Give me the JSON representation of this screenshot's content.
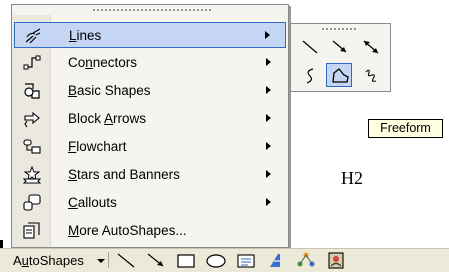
{
  "menu": {
    "items": [
      {
        "label": "Lines",
        "accel": "L",
        "rest": "ines",
        "pre": "",
        "icon": "lines-icon",
        "submenu": true
      },
      {
        "label": "Connectors",
        "pre": "Co",
        "accel": "n",
        "rest": "nectors",
        "icon": "connectors-icon",
        "submenu": true
      },
      {
        "label": "Basic Shapes",
        "pre": "",
        "accel": "B",
        "rest": "asic Shapes",
        "icon": "basic-shapes-icon",
        "submenu": true
      },
      {
        "label": "Block Arrows",
        "pre": "Block ",
        "accel": "A",
        "rest": "rrows",
        "icon": "block-arrows-icon",
        "submenu": true
      },
      {
        "label": "Flowchart",
        "pre": "",
        "accel": "F",
        "rest": "lowchart",
        "icon": "flowchart-icon",
        "submenu": true
      },
      {
        "label": "Stars and Banners",
        "pre": "",
        "accel": "S",
        "rest": "tars and Banners",
        "icon": "stars-banners-icon",
        "submenu": true
      },
      {
        "label": "Callouts",
        "pre": "",
        "accel": "C",
        "rest": "allouts",
        "icon": "callouts-icon",
        "submenu": true
      },
      {
        "label": "More AutoShapes...",
        "pre": "",
        "accel": "M",
        "rest": "ore AutoShapes...",
        "icon": "more-autoshapes-icon",
        "submenu": false
      }
    ]
  },
  "lines_submenu": {
    "tools": [
      {
        "name": "line-tool",
        "icon": "line-icon"
      },
      {
        "name": "arrow-tool",
        "icon": "arrow-icon"
      },
      {
        "name": "double-arrow-tool",
        "icon": "double-arrow-icon"
      },
      {
        "name": "curve-tool",
        "icon": "curve-icon"
      },
      {
        "name": "freeform-tool",
        "icon": "freeform-icon",
        "selected": true
      },
      {
        "name": "scribble-tool",
        "icon": "scribble-icon"
      }
    ]
  },
  "tooltip": {
    "text": "Freeform"
  },
  "document": {
    "text": "H2"
  },
  "toolbar": {
    "autoshapes_pre": "A",
    "autoshapes_accel": "u",
    "autoshapes_rest": "toShapes",
    "tools": [
      "line-icon",
      "arrow-icon",
      "rectangle-icon",
      "oval-icon",
      "text-box-icon",
      "wordart-icon",
      "diagram-icon",
      "clip-art-icon"
    ]
  },
  "colors": {
    "selection_fill": "#c5d6f4",
    "selection_border": "#3169c6",
    "menu_background": "#f6f4ef",
    "tooltip_background": "#ffffe1",
    "toolbar_background": "#ece9d8"
  }
}
